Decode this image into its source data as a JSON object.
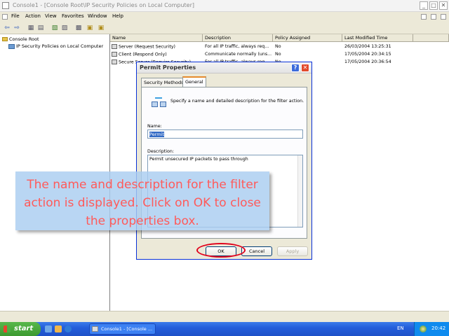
{
  "window": {
    "title": "Console1 - [Console Root\\IP Security Policies on Local Computer]",
    "min": "_",
    "max": "□",
    "close": "✕"
  },
  "menu": [
    "File",
    "Action",
    "View",
    "Favorites",
    "Window",
    "Help"
  ],
  "toolbar": [
    "⇦",
    "⇨",
    "▦",
    "▤",
    "▧",
    "▨",
    "▩",
    "▣"
  ],
  "tree": {
    "root": "Console Root",
    "child": "IP Security Policies on Local Computer"
  },
  "list": {
    "columns": [
      "Name",
      "Description",
      "Policy Assigned",
      "Last Modified Time"
    ],
    "rows": [
      {
        "name": "Server (Request Security)",
        "description": "For all IP traffic, always req...",
        "assigned": "No",
        "modified": "26/03/2004 13:25:31"
      },
      {
        "name": "Client (Respond Only)",
        "description": "Communicate normally (uns...",
        "assigned": "No",
        "modified": "17/05/2004 20:34:15"
      },
      {
        "name": "Secure Server (Require Security)",
        "description": "For all IP traffic, always req...",
        "assigned": "No",
        "modified": "17/05/2004 20:36:54"
      }
    ]
  },
  "dialog": {
    "title": "Permit Properties",
    "help": "?",
    "close": "✕",
    "tabs": [
      "Security Methods",
      "General"
    ],
    "intro": "Specify a name and detailed description for the filter action.",
    "name_label": "Name:",
    "name_value": "Permit",
    "description_label": "Description:",
    "description_value": "Permit unsecured IP packets to pass through",
    "buttons": {
      "ok": "OK",
      "cancel": "Cancel",
      "apply": "Apply"
    }
  },
  "callout": {
    "text": "The name and description for the filter action is displayed. Click on OK to close the properties box."
  },
  "taskbar": {
    "start": "start",
    "task": "Console1 - [Console ...",
    "language": "EN",
    "clock": "20:42"
  }
}
